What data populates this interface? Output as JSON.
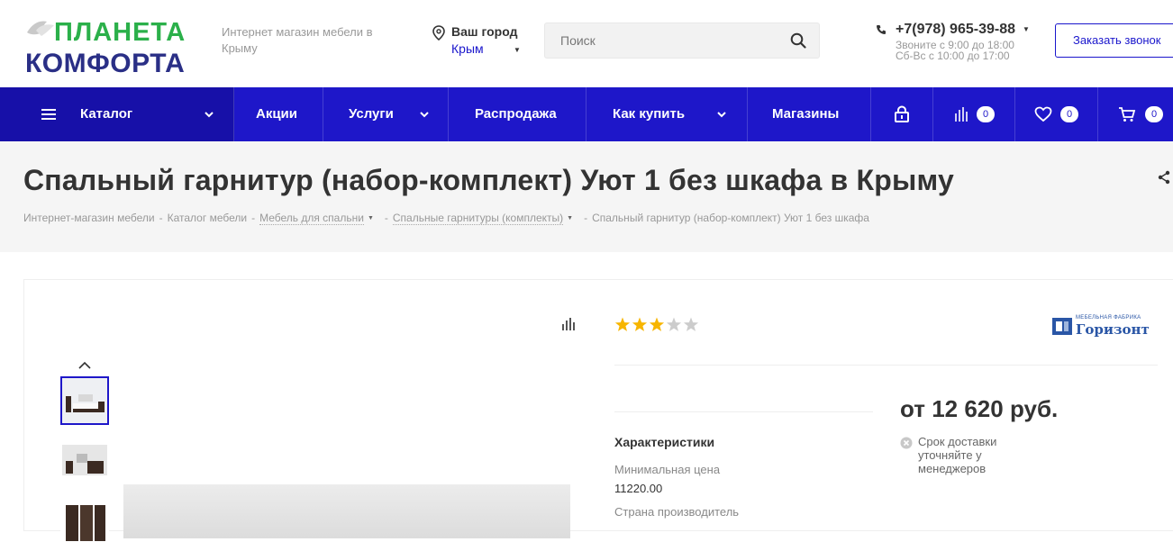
{
  "header": {
    "logo_top": "ПЛАНЕТА",
    "logo_bottom": "КОМФОРТА",
    "slogan": "Интернет магазин мебели в Крыму",
    "city_label": "Ваш город",
    "city_value": "Крым",
    "search_placeholder": "Поиск",
    "phone": "+7(978) 965-39-88",
    "hours_1": "Звоните с 9:00 до 18:00",
    "hours_2": "Сб-Вс  с 10:00 до 17:00",
    "callback_label": "Заказать звонок"
  },
  "nav": {
    "catalog": "Каталог",
    "promo": "Акции",
    "services": "Услуги",
    "sale": "Распродажа",
    "how_to_buy": "Как купить",
    "stores": "Магазины",
    "compare_count": "0",
    "favorites_count": "0",
    "cart_count": "0"
  },
  "page": {
    "title": "Спальный гарнитур (набор-комплект) Уют 1 без шкафа в Крыму",
    "breadcrumbs": [
      "Интернет-магазин мебели",
      "Каталог мебели",
      "Мебель для спальни",
      "Спальные гарнитуры (комплекты)",
      "Спальный гарнитур (набор-комплект) Уют 1 без шкафа"
    ]
  },
  "product": {
    "rating": 3,
    "rating_max": 5,
    "brand_small": "МЕБЕЛЬНАЯ ФАБРИКА",
    "brand_name": "Горизонт",
    "price": "от 12 620 руб.",
    "delivery_note": "Срок доставки уточняйте у менеджеров",
    "props_title": "Характеристики",
    "props": [
      {
        "label": "Минимальная цена",
        "value": "11220.00"
      },
      {
        "label": "Страна производитель",
        "value": ""
      }
    ]
  },
  "colors": {
    "accent": "#1e17c9",
    "star_on": "#f7b500",
    "star_off": "#cccccc"
  }
}
